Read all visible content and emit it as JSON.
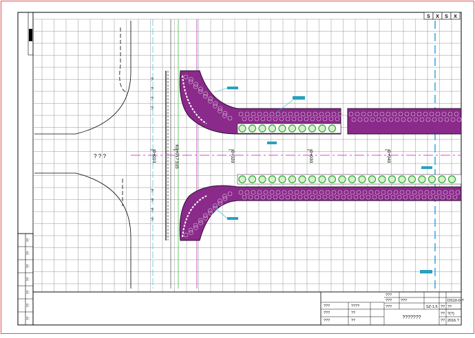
{
  "colors": {
    "outer_border": "#e05050",
    "frame": "#000000",
    "grid": "#808080",
    "planting": "#8a2a8a",
    "planting_dark": "#2a1030",
    "shrub": "#2fa82f",
    "centerline": "#e040e0",
    "cyan": "#20b0e0",
    "green_line": "#40c040",
    "label_bg": "#2aa0c0"
  },
  "header_cells": [
    "S",
    "X",
    "S",
    "X"
  ],
  "left_labels": [
    "? ? ?"
  ],
  "question_marks": [
    "?",
    "?",
    "?",
    "?",
    "?",
    "?",
    "?",
    "?"
  ],
  "stations": [
    "0+010",
    "K0+017.515",
    "0+020",
    "0+030",
    "0+040"
  ],
  "title_block": {
    "rows": [
      [
        "???",
        "????",
        "???"
      ],
      [
        "???",
        "??",
        "???"
      ],
      [
        "???",
        "??",
        "????????"
      ]
    ],
    "top_right": [
      "???",
      "???",
      "???",
      "???",
      "SZ-1.5"
    ],
    "right_col": [
      "??",
      "??",
      "??"
    ],
    "right_vals": [
      "DS10-0-?",
      "??",
      "?(?)",
      "2016.?"
    ],
    "drawing_title": "???????"
  },
  "left_strip": [
    "??",
    "??",
    "??",
    "??",
    "??",
    "??",
    "??"
  ]
}
